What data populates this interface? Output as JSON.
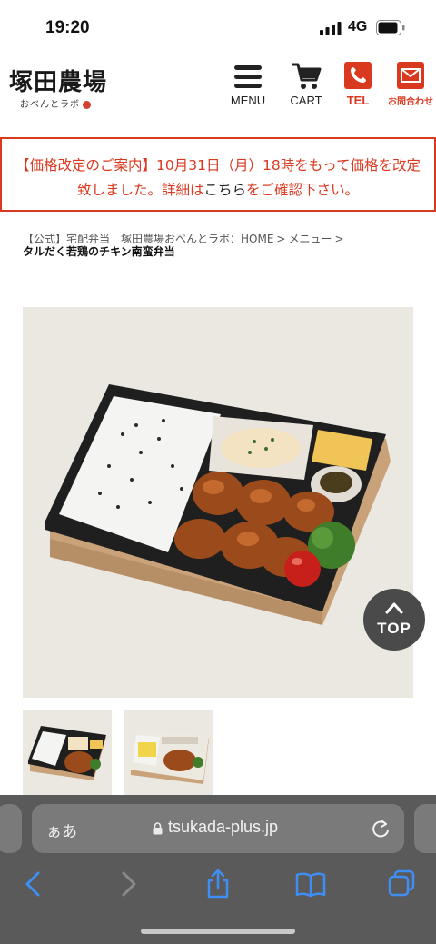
{
  "status_bar": {
    "time": "19:20",
    "network": "4G"
  },
  "header": {
    "logo_text": "塚田農場",
    "logo_sub": "おべんとラボ",
    "nav": [
      {
        "label": "MENU",
        "icon": "hamburger-icon"
      },
      {
        "label": "CART",
        "icon": "cart-icon"
      },
      {
        "label": "TEL",
        "icon": "phone-icon"
      },
      {
        "label": "お問合わせ",
        "icon": "mail-icon"
      }
    ],
    "accent_color": "#d9391f"
  },
  "notice": {
    "text_before": "【価格改定のご案内】10月31日（月）18時をもって価格を改定致しました。詳細は",
    "link_text": "こちら",
    "text_after": "をご確認下さい。"
  },
  "breadcrumb": {
    "items": [
      "【公式】宅配弁当　塚田農場おべんとラボ：HOME",
      "メニュー"
    ],
    "separator": ">",
    "current": "タルだく若鶏のチキン南蛮弁当"
  },
  "gallery": {
    "top_button_label": "TOP",
    "thumbnail_count": 2
  },
  "browser": {
    "aa_label": "ぁあ",
    "url": "tsukada-plus.jp"
  }
}
